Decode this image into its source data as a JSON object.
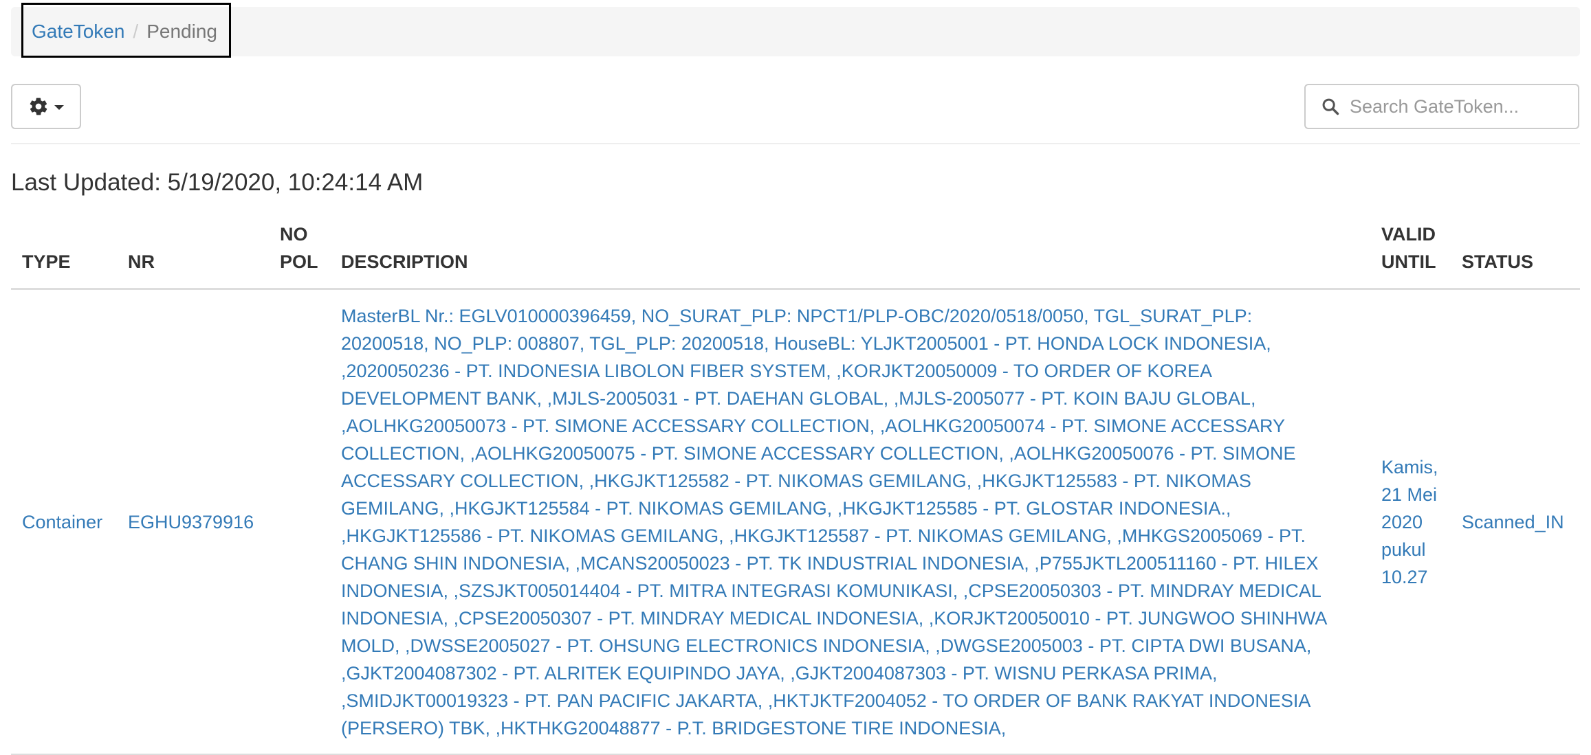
{
  "breadcrumb": {
    "root": "GateToken",
    "separator": "/",
    "current": "Pending"
  },
  "toolbar": {
    "settings_icon": "gear-icon",
    "settings_caret": "caret-down-icon"
  },
  "search": {
    "icon": "search-icon",
    "placeholder": "Search GateToken..."
  },
  "last_updated": "Last Updated: 5/19/2020, 10:24:14 AM",
  "table": {
    "headers": {
      "type": "TYPE",
      "nr": "NR",
      "no_pol_line1": "NO",
      "no_pol_line2": "POL",
      "description": "DESCRIPTION",
      "valid_line1": "VALID",
      "valid_line2": "UNTIL",
      "status": "STATUS"
    },
    "rows": [
      {
        "type": "Container",
        "nr": "EGHU9379916",
        "no_pol": "",
        "description_lines": [
          "MasterBL Nr.: EGLV010000396459, NO_SURAT_PLP: NPCT1/PLP-OBC/2020/0518/0050, TGL_SURAT_PLP:",
          "20200518, NO_PLP: 008807, TGL_PLP: 20200518, HouseBL: YLJKT2005001 - PT. HONDA LOCK INDONESIA,",
          ",2020050236 - PT. INDONESIA LIBOLON FIBER SYSTEM, ,KORJKT20050009 - TO ORDER OF KOREA",
          "DEVELOPMENT BANK, ,MJLS-2005031 - PT. DAEHAN GLOBAL, ,MJLS-2005077 - PT. KOIN BAJU GLOBAL,",
          ",AOLHKG20050073 - PT. SIMONE ACCESSARY COLLECTION, ,AOLHKG20050074 - PT. SIMONE ACCESSARY",
          "COLLECTION, ,AOLHKG20050075 - PT. SIMONE ACCESSARY COLLECTION, ,AOLHKG20050076 - PT. SIMONE",
          "ACCESSARY COLLECTION, ,HKGJKT125582 - PT. NIKOMAS GEMILANG, ,HKGJKT125583 - PT. NIKOMAS",
          "GEMILANG, ,HKGJKT125584 - PT. NIKOMAS GEMILANG, ,HKGJKT125585 - PT. GLOSTAR INDONESIA.,",
          ",HKGJKT125586 - PT. NIKOMAS GEMILANG, ,HKGJKT125587 - PT. NIKOMAS GEMILANG, ,MHKGS2005069 - PT.",
          "CHANG SHIN INDONESIA, ,MCANS20050023 - PT. TK INDUSTRIAL INDONESIA, ,P755JKTL200511160 - PT. HILEX",
          "INDONESIA, ,SZSJKT005014404 - PT. MITRA INTEGRASI KOMUNIKASI, ,CPSE20050303 - PT. MINDRAY MEDICAL",
          "INDONESIA, ,CPSE20050307 - PT. MINDRAY MEDICAL INDONESIA, ,KORJKT20050010 - PT. JUNGWOO SHINHWA",
          "MOLD, ,DWSSE2005027 - PT. OHSUNG ELECTRONICS INDONESIA, ,DWGSE2005003 - PT. CIPTA DWI BUSANA,",
          ",GJKT2004087302 - PT. ALRITEK EQUIPINDO JAYA, ,GJKT2004087303 - PT. WISNU PERKASA PRIMA,",
          ",SMIDJKT00019323 - PT. PAN PACIFIC JAKARTA, ,HKTJKTF2004052 - TO ORDER OF BANK RAKYAT INDONESIA",
          "(PERSERO) TBK, ,HKTHKG20048877 - P.T. BRIDGESTONE TIRE INDONESIA,"
        ],
        "valid_until_lines": [
          "Kamis,",
          "21 Mei",
          "2020",
          "pukul",
          "10.27"
        ],
        "status": "Scanned_IN"
      }
    ]
  },
  "colors": {
    "link": "#337ab7",
    "text": "#333333",
    "muted": "#777777",
    "breadcrumb_bg": "#f5f5f5",
    "border": "#dddddd"
  }
}
